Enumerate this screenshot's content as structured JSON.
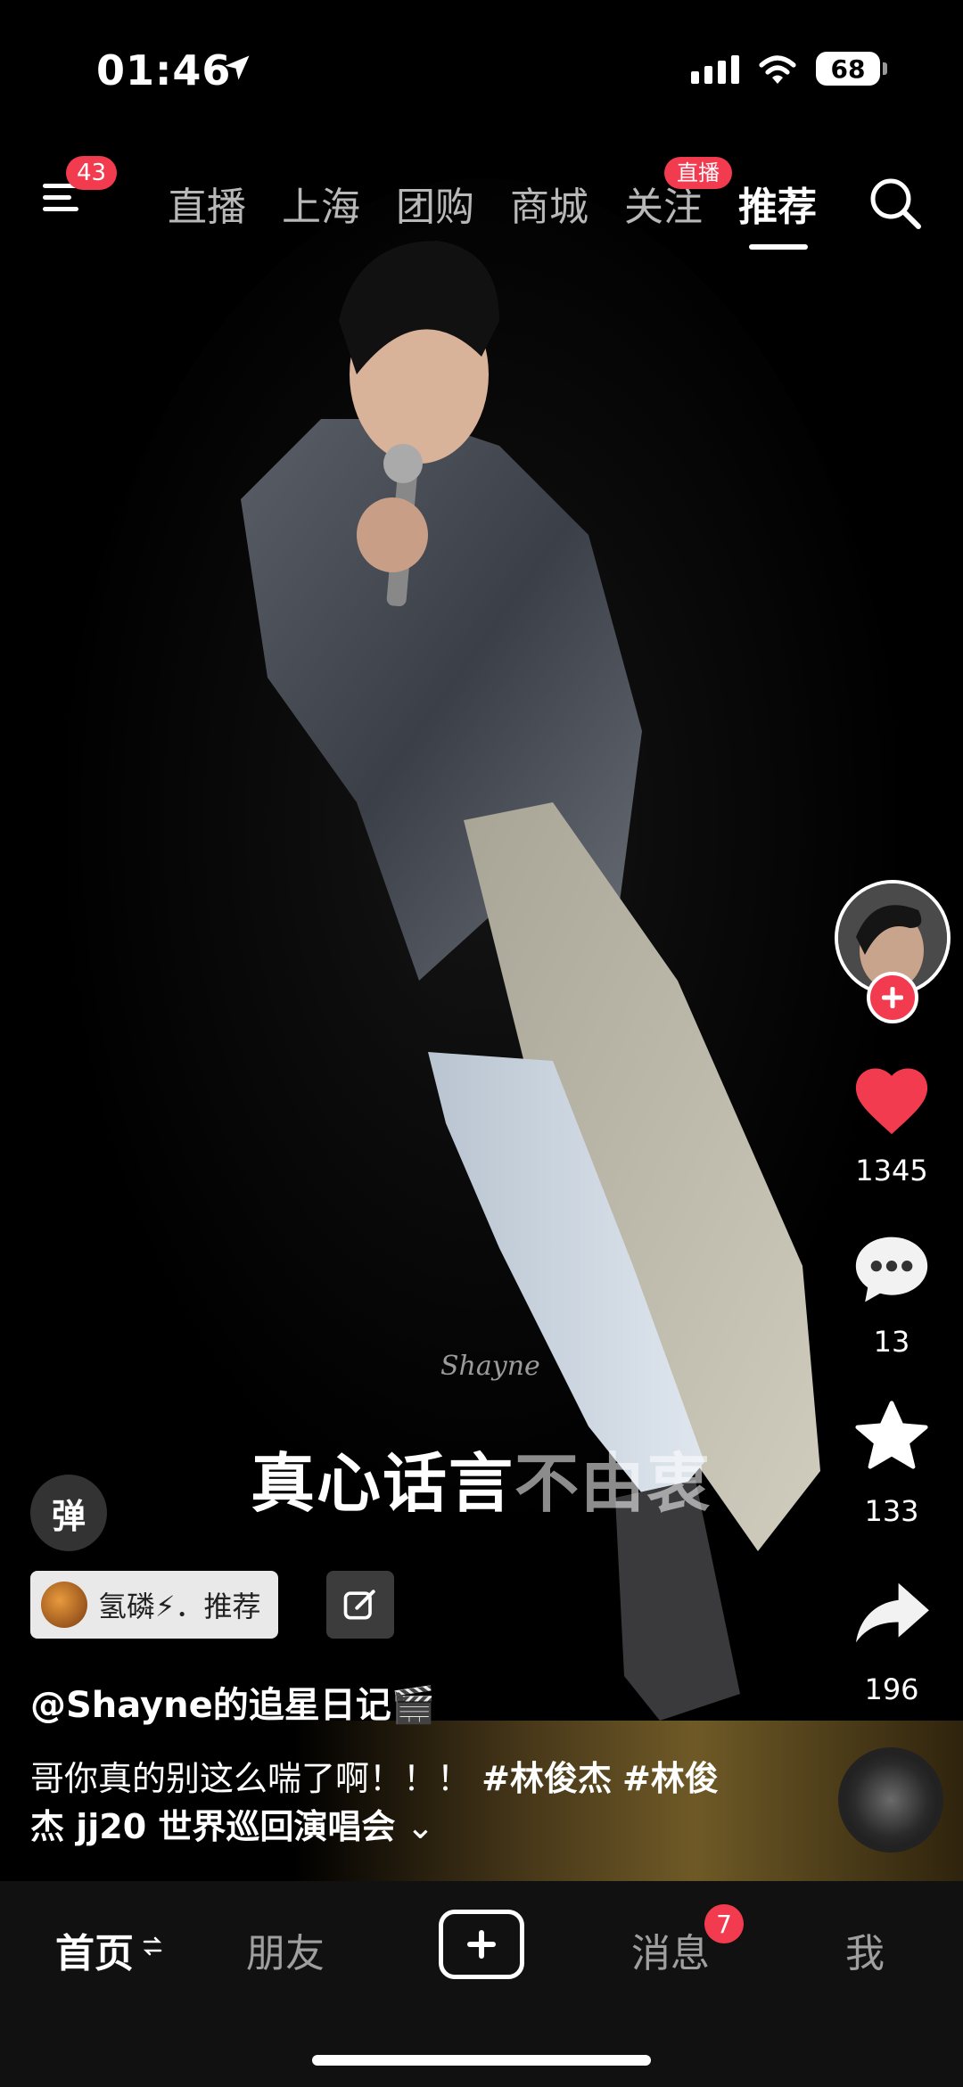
{
  "status_bar": {
    "time": "01:46",
    "battery": "68"
  },
  "top_nav": {
    "menu_badge": "43",
    "tabs": [
      {
        "label": "直播"
      },
      {
        "label": "上海"
      },
      {
        "label": "团购"
      },
      {
        "label": "商城"
      },
      {
        "label": "关注",
        "badge": "直播"
      },
      {
        "label": "推荐",
        "active": true
      }
    ],
    "search_icon": "search-icon"
  },
  "video": {
    "subtitle_bright": "真心话言",
    "subtitle_dim": "不由衷",
    "watermark": "Shayne"
  },
  "right_rail": {
    "like_count": "1345",
    "comment_count": "13",
    "favorite_count": "133",
    "share_count": "196",
    "colors": {
      "like": "#f23b4f",
      "follow": "#f23b4f"
    }
  },
  "overlay": {
    "danmu_label": "弹",
    "tag_text": "氢磷⚡．推荐",
    "author": "@Shayne的追星日记🎬",
    "desc_text": "哥你真的别这么喘了啊！！！",
    "hashtag1": "#林俊杰",
    "hashtag2": "#林俊杰 jj20 世界巡回演唱会",
    "expand": "⌄"
  },
  "bottom_nav": {
    "home": "首页",
    "friends": "朋友",
    "messages": "消息",
    "messages_badge": "7",
    "me": "我"
  }
}
